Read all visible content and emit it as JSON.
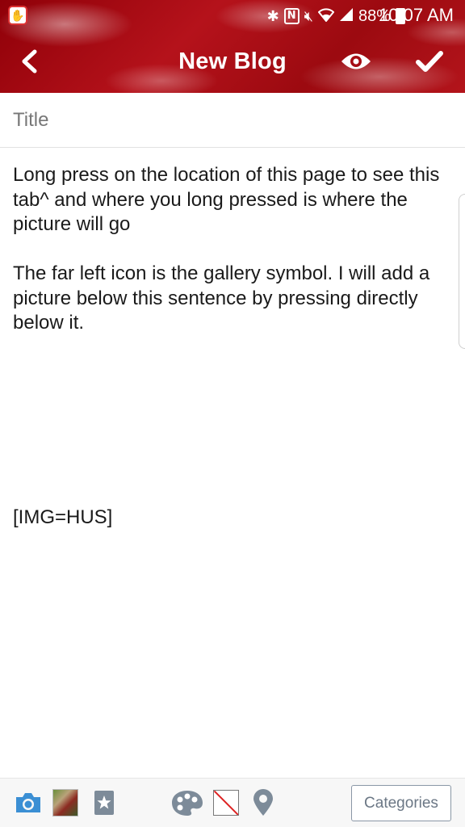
{
  "status_bar": {
    "battery_percent": "88%",
    "time": "10:07 AM",
    "icons": [
      "bluetooth-icon",
      "nfc-icon",
      "mute-icon",
      "wifi-icon",
      "signal-icon",
      "battery-icon"
    ]
  },
  "app_bar": {
    "title": "New Blog",
    "back_icon": "chevron-left-icon",
    "preview_icon": "eye-icon",
    "done_icon": "check-icon"
  },
  "title_field": {
    "placeholder": "Title",
    "value": ""
  },
  "content": {
    "paragraph_1": "Long press on the location of this page to see this tab^ and where you long pressed is where the picture will go",
    "paragraph_2": "The far left icon is the gallery symbol. I will add a picture below this sentence by pressing directly below it.",
    "image_tag": "[IMG=HUS]"
  },
  "toolbar": {
    "tools": [
      "camera-icon",
      "gallery-thumbnail",
      "star-icon",
      "palette-icon",
      "no-background-icon",
      "location-pin-icon"
    ],
    "categories_label": "Categories"
  },
  "colors": {
    "header_red": "#b5121b",
    "toolbar_blue": "#3b8fd4",
    "toolbar_gray": "#7d8b99"
  }
}
